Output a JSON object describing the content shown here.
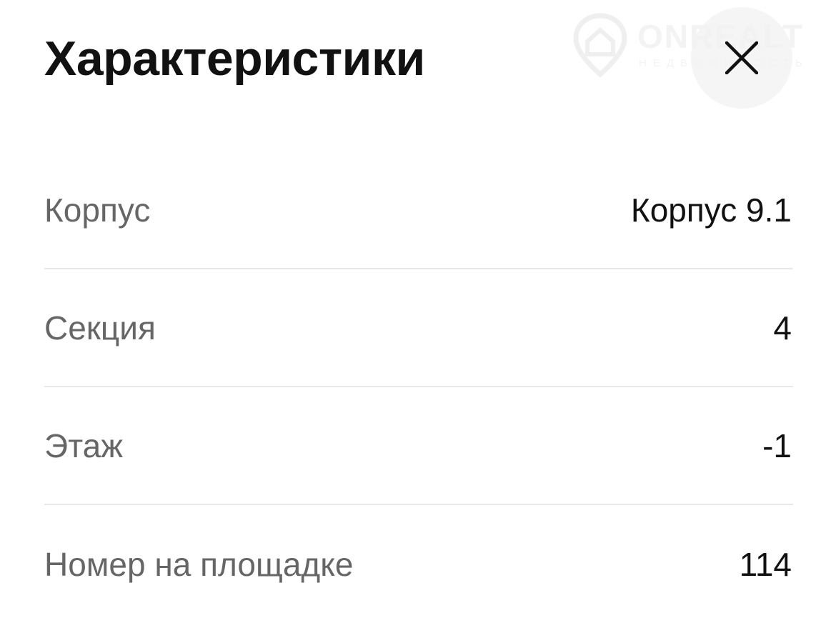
{
  "header": {
    "title": "Характеристики",
    "close_icon": "close-icon"
  },
  "watermark": {
    "brand": "ONREALT",
    "subtitle": "НЕДВИЖИМОСТЬ"
  },
  "characteristics": [
    {
      "label": "Корпус",
      "value": "Корпус 9.1"
    },
    {
      "label": "Секция",
      "value": "4"
    },
    {
      "label": "Этаж",
      "value": "-1"
    },
    {
      "label": "Номер на площадке",
      "value": "114"
    }
  ],
  "colors": {
    "background": "#ffffff",
    "text_primary": "#111111",
    "text_secondary": "#666666",
    "divider": "#e8e8e8",
    "close_button_bg": "#f2f2f2"
  }
}
